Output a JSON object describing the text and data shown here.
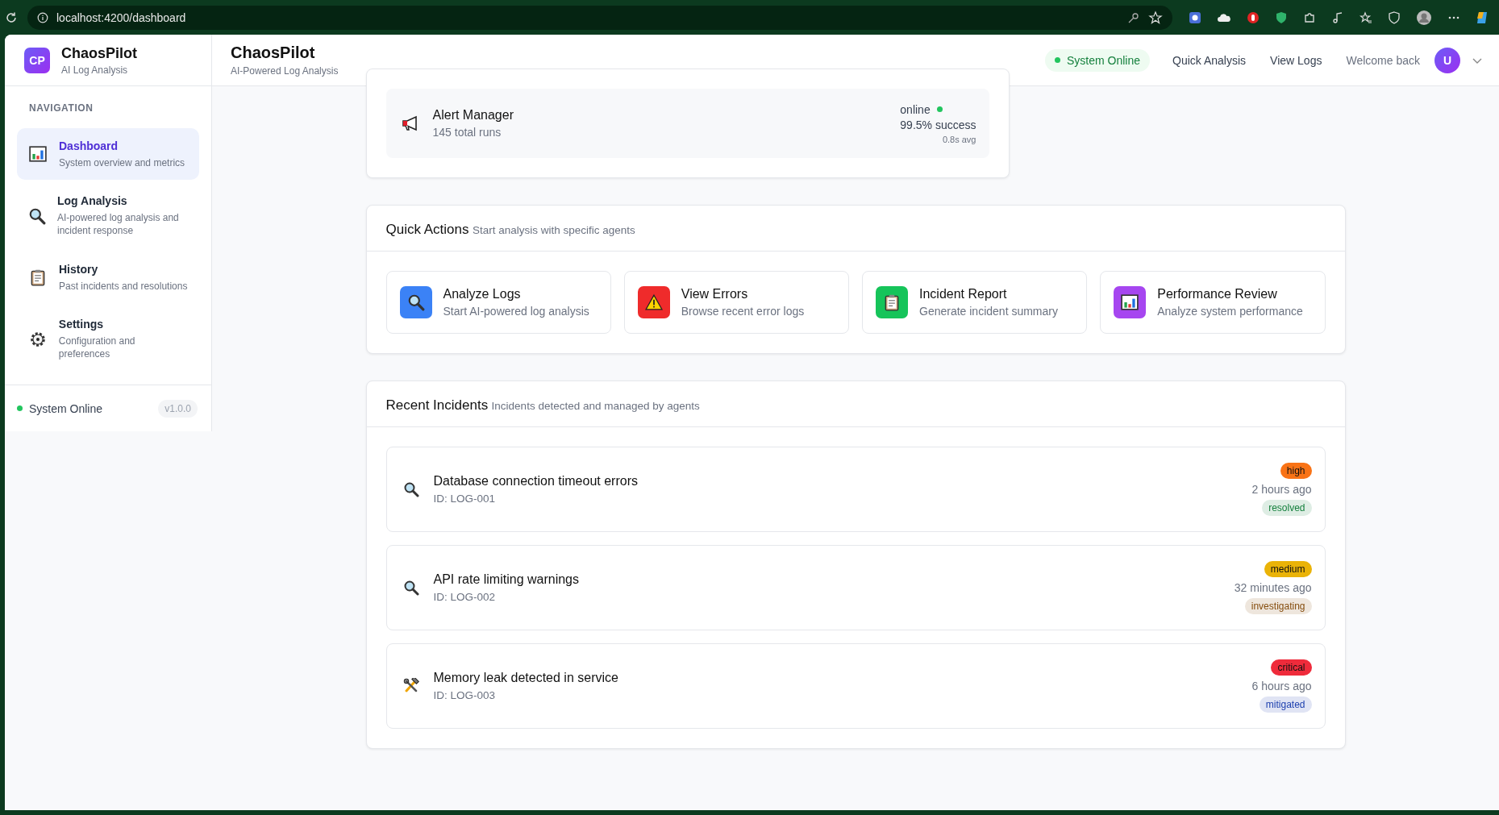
{
  "browser": {
    "url": "localhost:4200/dashboard"
  },
  "sidebar": {
    "brand": {
      "logo": "CP",
      "name": "ChaosPilot",
      "tagline": "AI Log Analysis"
    },
    "section_label": "NAVIGATION",
    "items": [
      {
        "kind": "chart",
        "label": "Dashboard",
        "description": "System overview and metrics",
        "selected": true
      },
      {
        "kind": "search",
        "label": "Log Analysis",
        "description": "AI-powered log analysis and incident response",
        "selected": false
      },
      {
        "kind": "clipboard",
        "label": "History",
        "description": "Past incidents and resolutions",
        "selected": false
      },
      {
        "kind": "gear",
        "label": "Settings",
        "description": "Configuration and preferences",
        "selected": false
      }
    ],
    "footer": {
      "status": "System Online",
      "version": "v1.0.0"
    }
  },
  "header": {
    "title": "ChaosPilot",
    "subtitle": "AI-Powered Log Analysis",
    "status": "System Online",
    "links": [
      "Quick Analysis",
      "View Logs"
    ],
    "welcome": "Welcome back",
    "avatar": "U"
  },
  "agent": {
    "name": "Alert Manager",
    "runs": "145 total runs",
    "status": "online",
    "success": "99.5% success",
    "avg": "0.8s avg"
  },
  "quick_actions": {
    "title": "Quick Actions",
    "subtitle": "Start analysis with specific agents",
    "actions": [
      {
        "kind": "search",
        "title": "Analyze Logs",
        "description": "Start AI-powered log analysis",
        "color": "#3b82f6"
      },
      {
        "kind": "warning",
        "title": "View Errors",
        "description": "Browse recent error logs",
        "color": "#ef2b2b"
      },
      {
        "kind": "clipboard",
        "title": "Incident Report",
        "description": "Generate incident summary",
        "color": "#16c45a"
      },
      {
        "kind": "chart",
        "title": "Performance Review",
        "description": "Analyze system performance",
        "color": "#a646f0"
      }
    ]
  },
  "recent_incidents": {
    "title": "Recent Incidents",
    "subtitle": "Incidents detected and managed by agents",
    "incidents": [
      {
        "kind": "search",
        "title": "Database connection timeout errors",
        "id": "ID: LOG-001",
        "severity": {
          "label": "high",
          "color": "#f97316"
        },
        "time": "2 hours ago",
        "status": {
          "label": "resolved",
          "color": "#15803d"
        }
      },
      {
        "kind": "search",
        "title": "API rate limiting warnings",
        "id": "ID: LOG-002",
        "severity": {
          "label": "medium",
          "color": "#eab308"
        },
        "time": "32 minutes ago",
        "status": {
          "label": "investigating",
          "color": "#854d0e"
        }
      },
      {
        "kind": "tools",
        "title": "Memory leak detected in service",
        "id": "ID: LOG-003",
        "severity": {
          "label": "critical",
          "color": "#ef2b3b"
        },
        "time": "6 hours ago",
        "status": {
          "label": "mitigated",
          "color": "#1e40af"
        }
      }
    ]
  }
}
